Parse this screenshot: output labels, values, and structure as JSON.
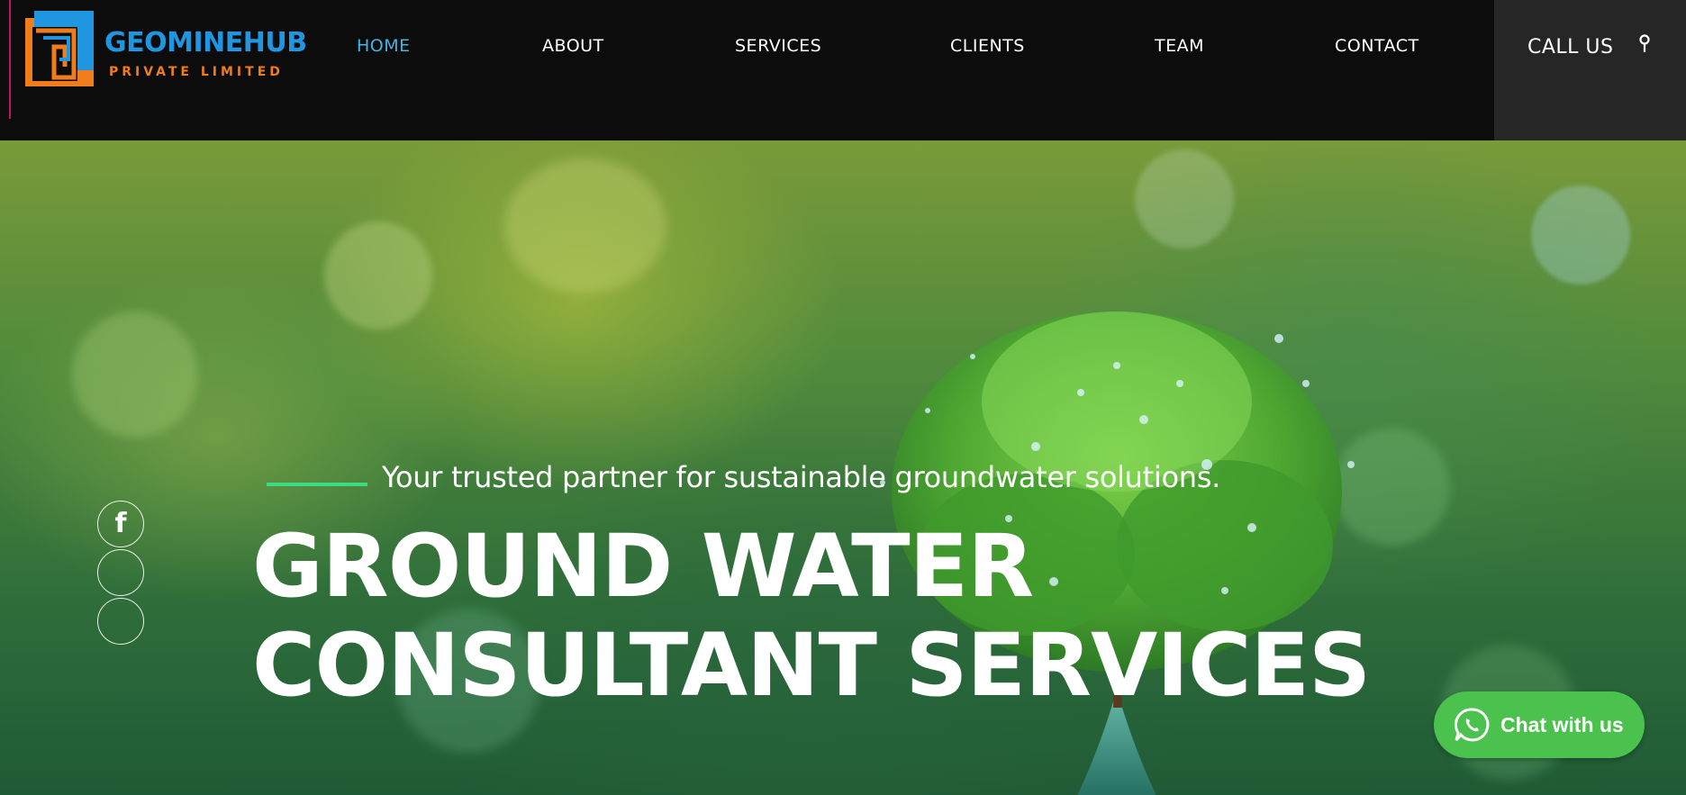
{
  "brand": {
    "name": "GEOMINEHUB",
    "subtitle": "PRIVATE LIMITED",
    "name_color": "#2196e0",
    "subtitle_color": "#f07c1c"
  },
  "nav": {
    "items": [
      {
        "label": "HOME",
        "active": true
      },
      {
        "label": "ABOUT",
        "active": false
      },
      {
        "label": "SERVICES",
        "active": false
      },
      {
        "label": "CLIENTS",
        "active": false
      },
      {
        "label": "TEAM",
        "active": false
      },
      {
        "label": "CONTACT",
        "active": false
      }
    ],
    "active_color": "#3fb6e8"
  },
  "call": {
    "label": "CALL US",
    "icon": "location-pin-icon"
  },
  "hero": {
    "tagline": "Your trusted partner for sustainable groundwater solutions.",
    "headline_line1": "GROUND WATER",
    "headline_line2": "CONSULTANT SERVICES",
    "accent_color": "#3ddc84"
  },
  "social": {
    "icons": [
      "facebook-icon",
      "social-icon-2",
      "social-icon-3"
    ],
    "facebook_glyph": "f"
  },
  "chat": {
    "label": "Chat with us",
    "icon": "whatsapp-icon",
    "color": "#4ac24d"
  }
}
